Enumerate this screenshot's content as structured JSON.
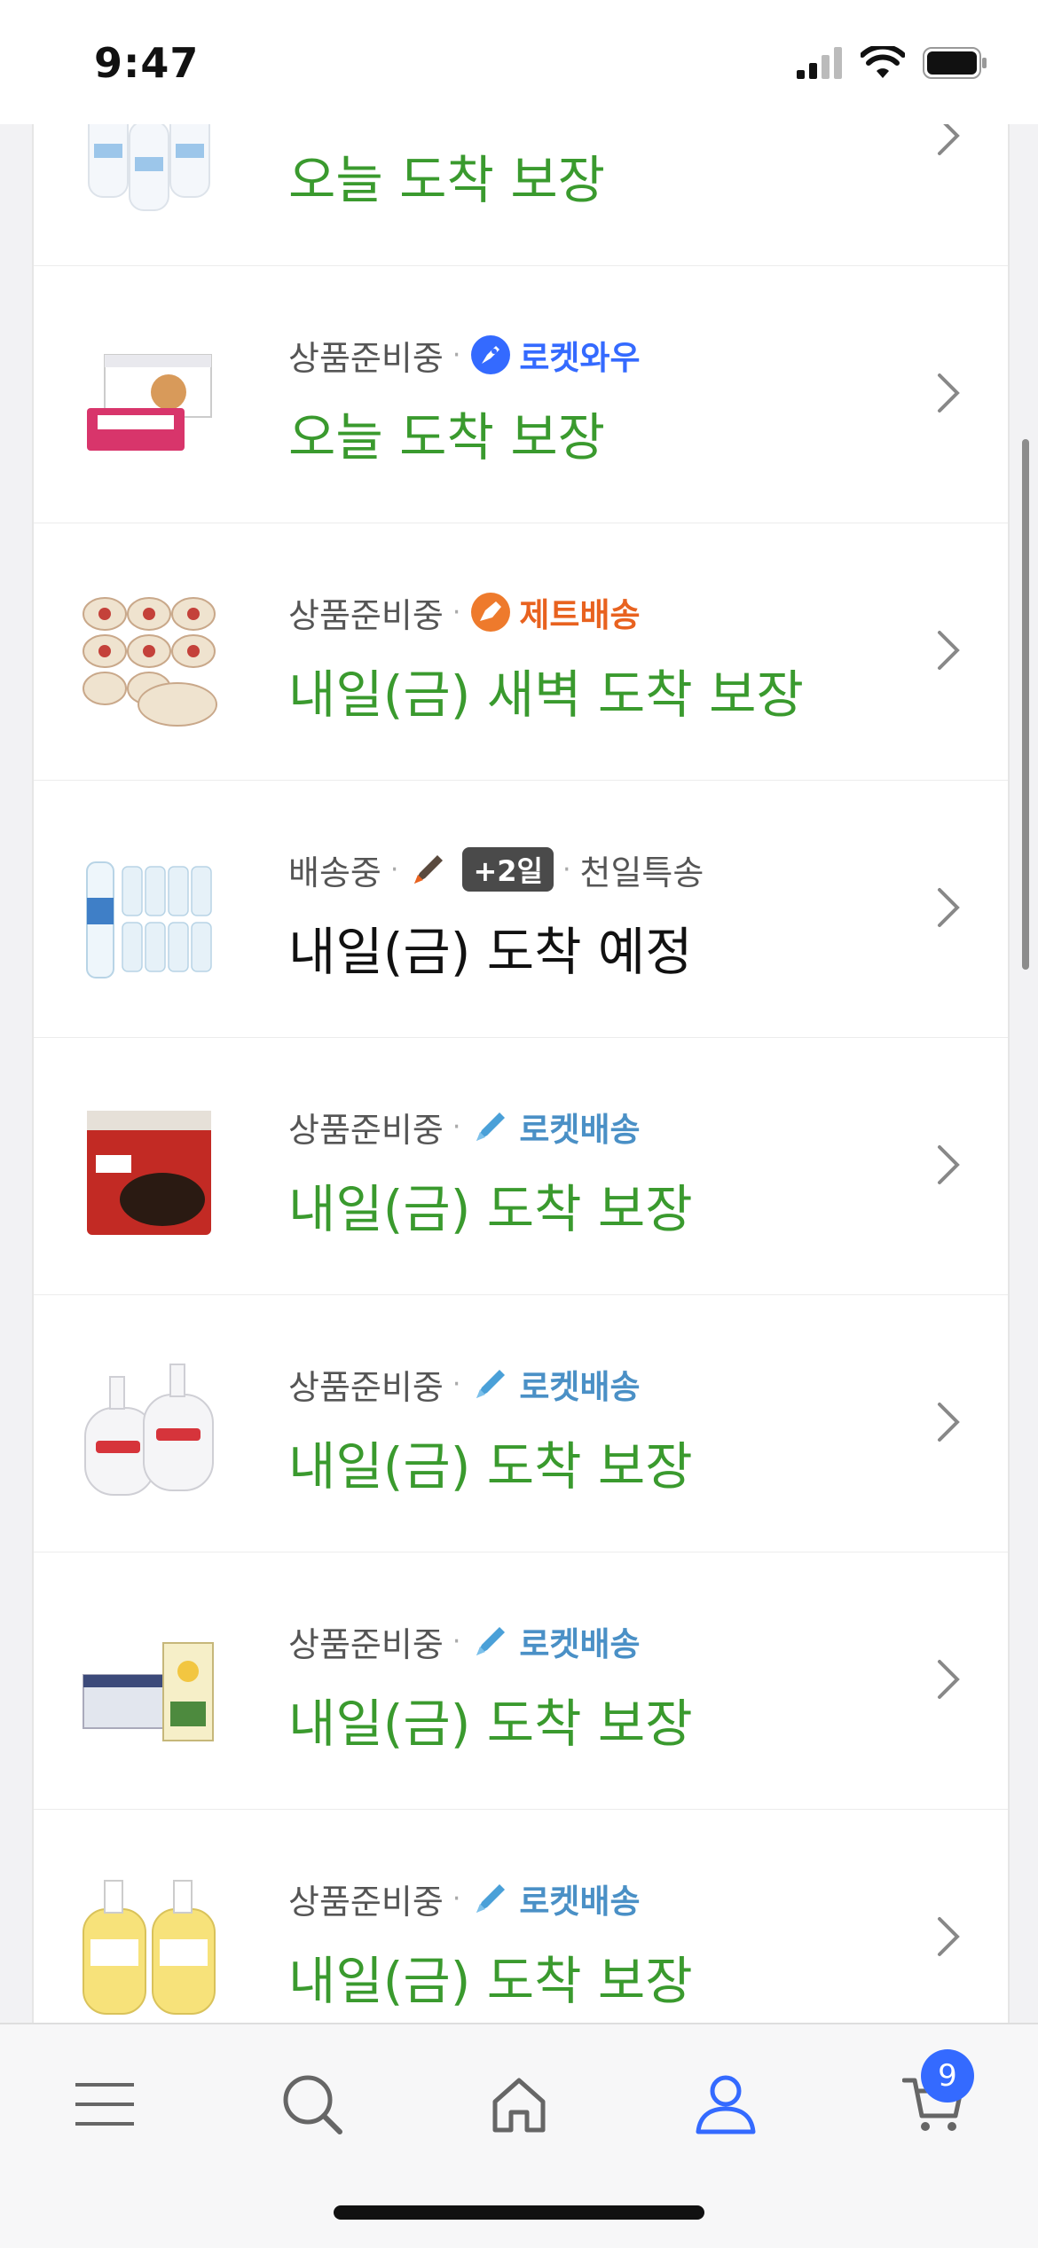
{
  "status_bar": {
    "time": "9:47"
  },
  "colors": {
    "guaranteed_green": "#3a9a2e",
    "expected_black": "#111111",
    "rocket_wow_blue": "#346aff",
    "jet_orange": "#e8621f",
    "rocket_blue": "#4aa0d8",
    "accent": "#346aff"
  },
  "orders": [
    {
      "status": "",
      "badge": "",
      "delivery": "오늘 도착 보장",
      "delivery_style": "guaranteed",
      "thumb_icon": "bottles-icon"
    },
    {
      "status": "상품준비중",
      "badge": "로켓와우",
      "badge_type": "rocket-wow",
      "delivery": "오늘 도착 보장",
      "delivery_style": "guaranteed",
      "thumb_icon": "box-pack-icon"
    },
    {
      "status": "상품준비중",
      "badge": "제트배송",
      "badge_type": "jet",
      "delivery": "내일(금) 새벽 도착 보장",
      "delivery_style": "guaranteed",
      "thumb_icon": "rice-bowls-icon"
    },
    {
      "status": "배송중",
      "badge": "+2일",
      "badge_type": "plus-days",
      "extra": "천일특송",
      "delivery": "내일(금) 도착 예정",
      "delivery_style": "expected",
      "thumb_icon": "water-bottles-icon"
    },
    {
      "status": "상품준비중",
      "badge": "로켓배송",
      "badge_type": "rocket",
      "delivery": "내일(금) 도착 보장",
      "delivery_style": "guaranteed",
      "thumb_icon": "noodle-pack-icon"
    },
    {
      "status": "상품준비중",
      "badge": "로켓배송",
      "badge_type": "rocket",
      "delivery": "내일(금) 도착 보장",
      "delivery_style": "guaranteed",
      "thumb_icon": "hand-soap-icon"
    },
    {
      "status": "상품준비중",
      "badge": "로켓배송",
      "badge_type": "rocket",
      "delivery": "내일(금) 도착 보장",
      "delivery_style": "guaranteed",
      "thumb_icon": "soymilk-box-icon"
    },
    {
      "status": "상품준비중",
      "badge": "로켓배송",
      "badge_type": "rocket",
      "delivery": "내일(금) 도착 보장",
      "delivery_style": "guaranteed",
      "thumb_icon": "yellow-soap-icon"
    }
  ],
  "bottom_nav": {
    "items": [
      "menu-icon",
      "search-icon",
      "home-icon",
      "my-account-icon",
      "cart-icon"
    ],
    "active": "my-account-icon",
    "cart_count": "9"
  }
}
